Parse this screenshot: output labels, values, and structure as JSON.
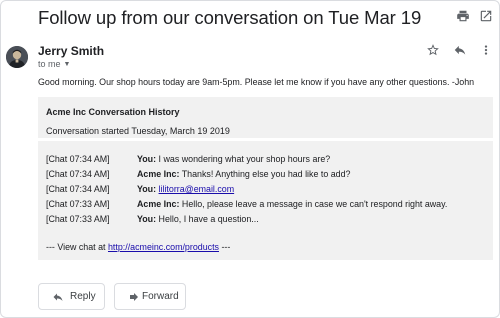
{
  "header": {
    "subject": "Follow up from our conversation on Tue Mar 19",
    "print_icon": "printer-icon",
    "popout_icon": "open-in-new-window-icon"
  },
  "message": {
    "sender_name": "Jerry Smith",
    "recipient": "to me",
    "star_icon": "star-outline-icon",
    "reply_icon": "reply-arrow-icon",
    "more_icon": "more-vertical-icon",
    "body_intro": "Good morning. Our shop hours today are 9am-5pm. Please let me know if you have any other questions. -John"
  },
  "history": {
    "title": "Acme Inc Conversation History",
    "started": "Conversation started Tuesday, March 19 2019",
    "chats": [
      {
        "time": "[Chat 07:34 AM]",
        "speaker": "You",
        "text": " I was wondering what your shop hours are?"
      },
      {
        "time": "[Chat 07:34 AM]",
        "speaker": "Acme Inc",
        "text": " Thanks! Anything else you had like to add?"
      },
      {
        "time": "[Chat 07:34 AM]",
        "speaker": "You",
        "link": "lilitorra@email.com"
      },
      {
        "time": "[Chat 07:33 AM]",
        "speaker": "Acme Inc",
        "text": " Hello, please leave a message in case we can't respond right away."
      },
      {
        "time": "[Chat 07:33 AM]",
        "speaker": "You",
        "text": " Hello, I have a question..."
      }
    ],
    "view_chat_prefix": "--- View chat at ",
    "view_chat_link": "http://acmeinc.com/products",
    "view_chat_suffix": " ---"
  },
  "actions": {
    "reply_label": "Reply",
    "forward_label": "Forward",
    "reply_icon": "reply-arrow-icon",
    "forward_icon": "forward-arrow-icon"
  }
}
